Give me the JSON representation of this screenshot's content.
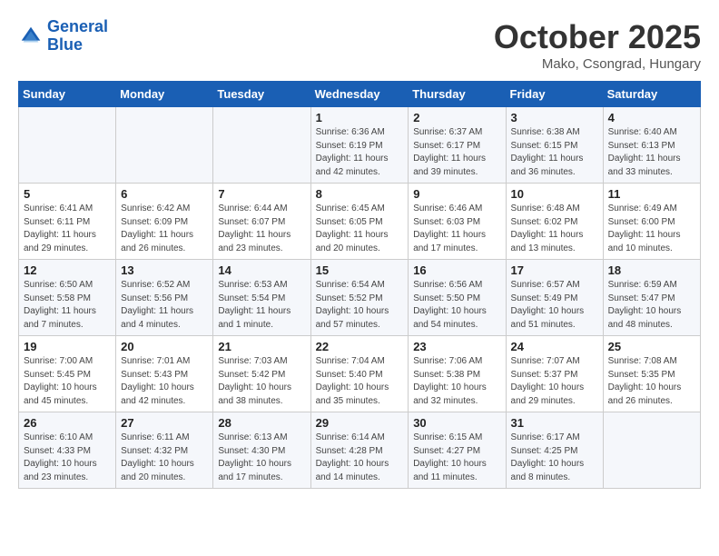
{
  "header": {
    "logo_line1": "General",
    "logo_line2": "Blue",
    "month": "October 2025",
    "location": "Mako, Csongrad, Hungary"
  },
  "weekdays": [
    "Sunday",
    "Monday",
    "Tuesday",
    "Wednesday",
    "Thursday",
    "Friday",
    "Saturday"
  ],
  "weeks": [
    [
      {
        "day": "",
        "info": ""
      },
      {
        "day": "",
        "info": ""
      },
      {
        "day": "",
        "info": ""
      },
      {
        "day": "1",
        "info": "Sunrise: 6:36 AM\nSunset: 6:19 PM\nDaylight: 11 hours\nand 42 minutes."
      },
      {
        "day": "2",
        "info": "Sunrise: 6:37 AM\nSunset: 6:17 PM\nDaylight: 11 hours\nand 39 minutes."
      },
      {
        "day": "3",
        "info": "Sunrise: 6:38 AM\nSunset: 6:15 PM\nDaylight: 11 hours\nand 36 minutes."
      },
      {
        "day": "4",
        "info": "Sunrise: 6:40 AM\nSunset: 6:13 PM\nDaylight: 11 hours\nand 33 minutes."
      }
    ],
    [
      {
        "day": "5",
        "info": "Sunrise: 6:41 AM\nSunset: 6:11 PM\nDaylight: 11 hours\nand 29 minutes."
      },
      {
        "day": "6",
        "info": "Sunrise: 6:42 AM\nSunset: 6:09 PM\nDaylight: 11 hours\nand 26 minutes."
      },
      {
        "day": "7",
        "info": "Sunrise: 6:44 AM\nSunset: 6:07 PM\nDaylight: 11 hours\nand 23 minutes."
      },
      {
        "day": "8",
        "info": "Sunrise: 6:45 AM\nSunset: 6:05 PM\nDaylight: 11 hours\nand 20 minutes."
      },
      {
        "day": "9",
        "info": "Sunrise: 6:46 AM\nSunset: 6:03 PM\nDaylight: 11 hours\nand 17 minutes."
      },
      {
        "day": "10",
        "info": "Sunrise: 6:48 AM\nSunset: 6:02 PM\nDaylight: 11 hours\nand 13 minutes."
      },
      {
        "day": "11",
        "info": "Sunrise: 6:49 AM\nSunset: 6:00 PM\nDaylight: 11 hours\nand 10 minutes."
      }
    ],
    [
      {
        "day": "12",
        "info": "Sunrise: 6:50 AM\nSunset: 5:58 PM\nDaylight: 11 hours\nand 7 minutes."
      },
      {
        "day": "13",
        "info": "Sunrise: 6:52 AM\nSunset: 5:56 PM\nDaylight: 11 hours\nand 4 minutes."
      },
      {
        "day": "14",
        "info": "Sunrise: 6:53 AM\nSunset: 5:54 PM\nDaylight: 11 hours\nand 1 minute."
      },
      {
        "day": "15",
        "info": "Sunrise: 6:54 AM\nSunset: 5:52 PM\nDaylight: 10 hours\nand 57 minutes."
      },
      {
        "day": "16",
        "info": "Sunrise: 6:56 AM\nSunset: 5:50 PM\nDaylight: 10 hours\nand 54 minutes."
      },
      {
        "day": "17",
        "info": "Sunrise: 6:57 AM\nSunset: 5:49 PM\nDaylight: 10 hours\nand 51 minutes."
      },
      {
        "day": "18",
        "info": "Sunrise: 6:59 AM\nSunset: 5:47 PM\nDaylight: 10 hours\nand 48 minutes."
      }
    ],
    [
      {
        "day": "19",
        "info": "Sunrise: 7:00 AM\nSunset: 5:45 PM\nDaylight: 10 hours\nand 45 minutes."
      },
      {
        "day": "20",
        "info": "Sunrise: 7:01 AM\nSunset: 5:43 PM\nDaylight: 10 hours\nand 42 minutes."
      },
      {
        "day": "21",
        "info": "Sunrise: 7:03 AM\nSunset: 5:42 PM\nDaylight: 10 hours\nand 38 minutes."
      },
      {
        "day": "22",
        "info": "Sunrise: 7:04 AM\nSunset: 5:40 PM\nDaylight: 10 hours\nand 35 minutes."
      },
      {
        "day": "23",
        "info": "Sunrise: 7:06 AM\nSunset: 5:38 PM\nDaylight: 10 hours\nand 32 minutes."
      },
      {
        "day": "24",
        "info": "Sunrise: 7:07 AM\nSunset: 5:37 PM\nDaylight: 10 hours\nand 29 minutes."
      },
      {
        "day": "25",
        "info": "Sunrise: 7:08 AM\nSunset: 5:35 PM\nDaylight: 10 hours\nand 26 minutes."
      }
    ],
    [
      {
        "day": "26",
        "info": "Sunrise: 6:10 AM\nSunset: 4:33 PM\nDaylight: 10 hours\nand 23 minutes."
      },
      {
        "day": "27",
        "info": "Sunrise: 6:11 AM\nSunset: 4:32 PM\nDaylight: 10 hours\nand 20 minutes."
      },
      {
        "day": "28",
        "info": "Sunrise: 6:13 AM\nSunset: 4:30 PM\nDaylight: 10 hours\nand 17 minutes."
      },
      {
        "day": "29",
        "info": "Sunrise: 6:14 AM\nSunset: 4:28 PM\nDaylight: 10 hours\nand 14 minutes."
      },
      {
        "day": "30",
        "info": "Sunrise: 6:15 AM\nSunset: 4:27 PM\nDaylight: 10 hours\nand 11 minutes."
      },
      {
        "day": "31",
        "info": "Sunrise: 6:17 AM\nSunset: 4:25 PM\nDaylight: 10 hours\nand 8 minutes."
      },
      {
        "day": "",
        "info": ""
      }
    ]
  ]
}
